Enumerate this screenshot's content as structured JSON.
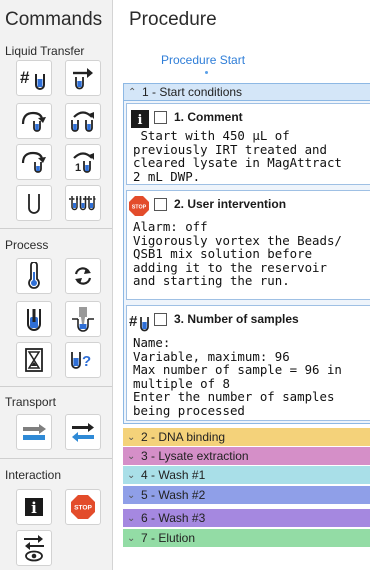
{
  "commands": {
    "title": "Commands",
    "groups": {
      "liquid_transfer": "Liquid Transfer",
      "process": "Process",
      "transport": "Transport",
      "interaction": "Interaction"
    },
    "icons": {
      "liquid_transfer": [
        "sample-count-tube-icon",
        "transfer-arrow-tube-icon",
        "aspirate-curve-icon",
        "aspirate-two-tubes-icon",
        "dispense-curve-icon",
        "dispense-numbered-tubes-icon",
        "tube-outline-icon",
        "multi-tube-transfer-icon"
      ],
      "process": [
        "thermometer-icon",
        "refresh-icon",
        "magnet-tube-icon",
        "pipette-tip-icon",
        "hourglass-icon",
        "tube-question-icon"
      ],
      "transport": [
        "transport-right-icon",
        "transport-swap-icon"
      ],
      "interaction": [
        "info-icon",
        "stop-icon",
        "toggle-view-icon"
      ]
    },
    "labels": {
      "sample_count": "#",
      "tube_number": "1",
      "tube_question": "?",
      "info": "i",
      "stop": "STOP"
    }
  },
  "procedure": {
    "title": "Procedure",
    "start_label": "Procedure Start",
    "sections": [
      {
        "label": "1 - Start conditions",
        "color": "#d4e6f8",
        "expanded": true
      },
      {
        "label": "2 - DNA binding",
        "color": "#f4d27a",
        "expanded": false
      },
      {
        "label": "3 - Lysate extraction",
        "color": "#d58fc8",
        "expanded": false
      },
      {
        "label": "4 - Wash #1",
        "color": "#a9dfe8",
        "expanded": false
      },
      {
        "label": "5 - Wash #2",
        "color": "#8f9fe8",
        "expanded": false
      },
      {
        "label": "6 - Wash #3",
        "color": "#a588e0",
        "expanded": false
      },
      {
        "label": "7 - Elution",
        "color": "#93dca5",
        "expanded": false
      }
    ],
    "steps": [
      {
        "title": "1. Comment",
        "icon": "info-icon",
        "icon_label": "i",
        "lines": [
          " Start with 450 µL of",
          "previously IRT treated and",
          "cleared lysate in MagAttract",
          "2 mL DWP."
        ]
      },
      {
        "title": "2. User intervention",
        "icon": "stop-icon",
        "icon_label": "STOP",
        "lines": [
          "Alarm: off",
          "Vigorously vortex the Beads/",
          "QSB1 mix solution before",
          "adding it to the reservoir",
          "and starting the run."
        ]
      },
      {
        "title": "3. Number of samples",
        "icon": "sample-count-tube-icon",
        "icon_label": "#",
        "lines": [
          "Name:",
          "Variable, maximum: 96",
          "Max number of sample = 96 in",
          "multiple of 8",
          "Enter the number of samples",
          "being processed"
        ]
      }
    ]
  },
  "colors": {
    "accent": "#2f7ed8",
    "tube_blue": "#2f6fd6",
    "stop_red": "#e34c2b",
    "start_section": "#d4e6f8"
  }
}
